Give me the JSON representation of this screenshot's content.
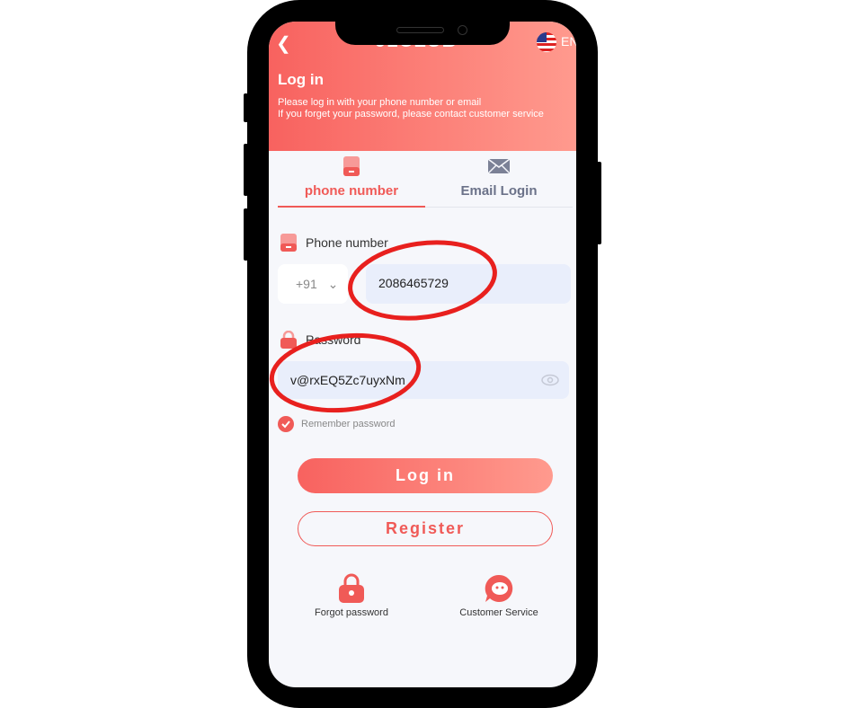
{
  "header": {
    "back_icon": "chevron-left-icon",
    "logo": "91CLUB",
    "language": "EN",
    "title": "Log in",
    "subtitle_line1": "Please log in with your phone number or email",
    "subtitle_line2": "If you forget your password, please contact customer service"
  },
  "tabs": [
    {
      "label": "phone number",
      "icon": "phone-icon",
      "active": true
    },
    {
      "label": "Email Login",
      "icon": "mail-icon",
      "active": false
    }
  ],
  "form": {
    "phone_label": "Phone number",
    "country_code": "+91",
    "phone_value": "2086465729",
    "password_label": "Password",
    "password_value": "v@rxEQ5Zc7uyxNm",
    "remember_label": "Remember password",
    "remember_checked": true
  },
  "actions": {
    "login": "Log in",
    "register": "Register"
  },
  "footer": {
    "forgot": "Forgot password",
    "service": "Customer Service"
  },
  "colors": {
    "accent": "#f05a57",
    "annotation": "#e8201e"
  }
}
